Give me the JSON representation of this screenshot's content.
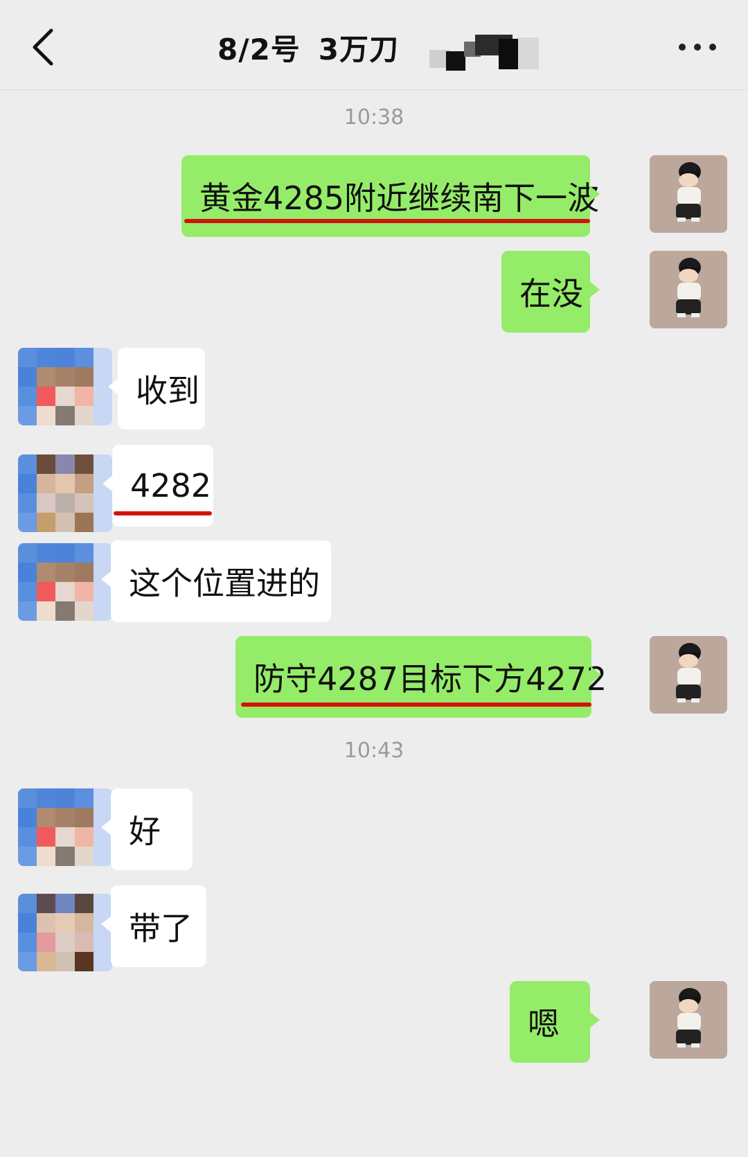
{
  "header": {
    "title_date": "8/2号",
    "title_amount": "3万刀",
    "back_icon": "chevron-left-icon",
    "more_icon": "more-dots-icon"
  },
  "timestamps": [
    "10:38",
    "10:43"
  ],
  "messages": [
    {
      "from": "me",
      "text": "黄金4285附近继续南下一波",
      "underlined": true
    },
    {
      "from": "me",
      "text": "在没",
      "underlined": false
    },
    {
      "from": "other",
      "text": "收到",
      "underlined": false
    },
    {
      "from": "other",
      "text": "4282",
      "underlined": true
    },
    {
      "from": "other",
      "text": "这个位置进的",
      "underlined": false
    },
    {
      "from": "me",
      "text": "防守4287目标下方4272",
      "underlined": true
    },
    {
      "from": "other",
      "text": "好",
      "underlined": false
    },
    {
      "from": "other",
      "text": "带了",
      "underlined": false
    },
    {
      "from": "me",
      "text": "嗯",
      "underlined": false
    }
  ],
  "colors": {
    "background": "#ededed",
    "my_bubble": "#95ec69",
    "other_bubble": "#ffffff",
    "annotation_underline": "#d4120c"
  }
}
